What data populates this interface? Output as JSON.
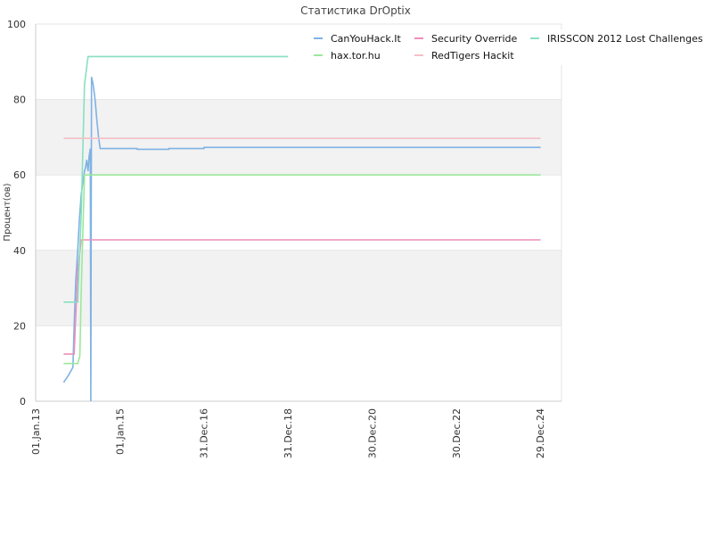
{
  "chart_data": {
    "type": "line",
    "title": "Статистика DrOptix",
    "xlabel": "",
    "ylabel": "Процент(ов)",
    "ylim": [
      0,
      100
    ],
    "yticks": [
      0,
      20,
      40,
      60,
      80,
      100
    ],
    "xlim": [
      "2013-01-01",
      "2025-07-01"
    ],
    "xticks": [
      {
        "date": "2013-01-01",
        "label": "01.Jan.13"
      },
      {
        "date": "2015-01-01",
        "label": "01.Jan.15"
      },
      {
        "date": "2016-12-31",
        "label": "31.Dec.16"
      },
      {
        "date": "2018-12-31",
        "label": "31.Dec.18"
      },
      {
        "date": "2020-12-30",
        "label": "30.Dec.20"
      },
      {
        "date": "2022-12-30",
        "label": "30.Dec.22"
      },
      {
        "date": "2024-12-29",
        "label": "29.Dec.24"
      }
    ],
    "grid": true,
    "legend_position": "top-right",
    "series": [
      {
        "name": "CanYouHack.It",
        "color": "#7fb2e5",
        "points": [
          [
            "2013-09-01",
            5
          ],
          [
            "2013-10-15",
            7
          ],
          [
            "2013-11-20",
            9
          ],
          [
            "2013-12-01",
            20
          ],
          [
            "2013-12-15",
            32
          ],
          [
            "2014-01-01",
            40
          ],
          [
            "2014-01-15",
            48
          ],
          [
            "2014-02-01",
            55
          ],
          [
            "2014-02-15",
            58
          ],
          [
            "2014-03-01",
            61
          ],
          [
            "2014-03-10",
            62
          ],
          [
            "2014-03-20",
            64
          ],
          [
            "2014-04-01",
            61
          ],
          [
            "2014-04-10",
            65
          ],
          [
            "2014-04-20",
            67
          ],
          [
            "2014-04-25",
            0
          ],
          [
            "2014-05-01",
            86
          ],
          [
            "2014-05-15",
            84
          ],
          [
            "2014-06-01",
            80
          ],
          [
            "2014-06-15",
            75
          ],
          [
            "2014-07-01",
            70
          ],
          [
            "2014-07-15",
            67
          ],
          [
            "2015-06-01",
            67
          ],
          [
            "2015-06-02",
            66.8
          ],
          [
            "2016-03-01",
            66.8
          ],
          [
            "2016-03-02",
            67
          ],
          [
            "2017-01-01",
            67
          ],
          [
            "2017-01-02",
            67.3
          ],
          [
            "2025-01-01",
            67.3
          ]
        ]
      },
      {
        "name": "Security Override",
        "color": "#ee8fb8",
        "points": [
          [
            "2013-09-01",
            12.5
          ],
          [
            "2013-12-01",
            12.5
          ],
          [
            "2014-01-01",
            35
          ],
          [
            "2014-02-01",
            42.8
          ],
          [
            "2025-01-01",
            42.8
          ]
        ]
      },
      {
        "name": "IRISSCON 2012 Lost Challenges",
        "color": "#88e0c0",
        "points": [
          [
            "2013-09-01",
            26.3
          ],
          [
            "2014-01-01",
            26.3
          ],
          [
            "2014-02-01",
            50
          ],
          [
            "2014-03-01",
            84
          ],
          [
            "2014-04-01",
            91.4
          ],
          [
            "2019-01-01",
            91.4
          ]
        ]
      },
      {
        "name": "hax.tor.hu",
        "color": "#9be89b",
        "points": [
          [
            "2013-09-01",
            10
          ],
          [
            "2014-01-01",
            10
          ],
          [
            "2014-01-20",
            12
          ],
          [
            "2014-02-01",
            30
          ],
          [
            "2014-02-15",
            45
          ],
          [
            "2014-03-01",
            60
          ],
          [
            "2025-01-01",
            60
          ]
        ]
      },
      {
        "name": "RedTigers Hackit",
        "color": "#f5c0c8",
        "points": [
          [
            "2013-09-01",
            69.7
          ],
          [
            "2025-01-01",
            69.7
          ]
        ]
      }
    ]
  }
}
